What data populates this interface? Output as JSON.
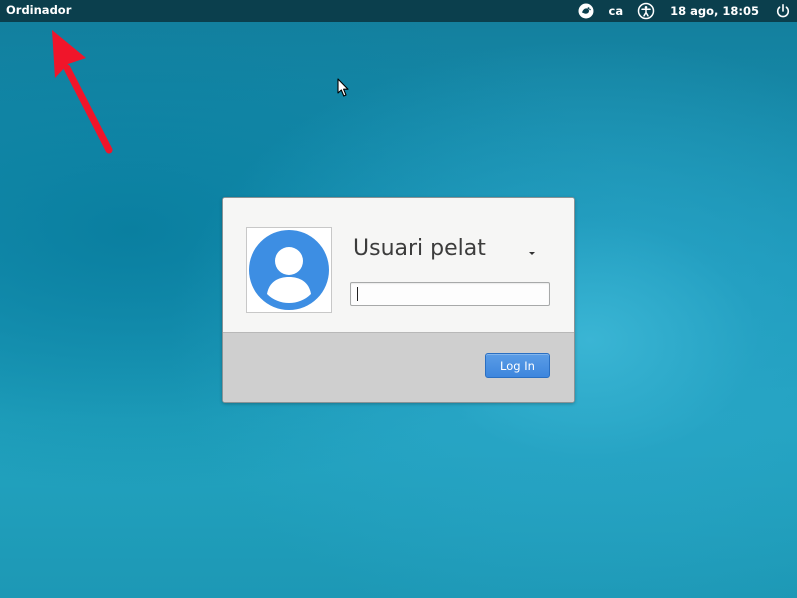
{
  "panel": {
    "computer_label": "Ordinador",
    "keyboard_icon": "keyboard-layout-icon",
    "language_label": "ca",
    "accessibility_icon": "accessibility-icon",
    "clock": "18 ago, 18:05",
    "power_icon": "power-icon"
  },
  "login": {
    "user_name": "Usuari pelat",
    "user_menu_icon": "chevron-down-icon",
    "avatar_icon": "user-avatar-icon",
    "password_value": "",
    "login_button_label": "Log In"
  },
  "colors": {
    "panel_bg": "#0b3f4d",
    "accent": "#3d86dd",
    "avatar_blue": "#3d8ee3",
    "annotation_arrow": "#f0152a"
  }
}
